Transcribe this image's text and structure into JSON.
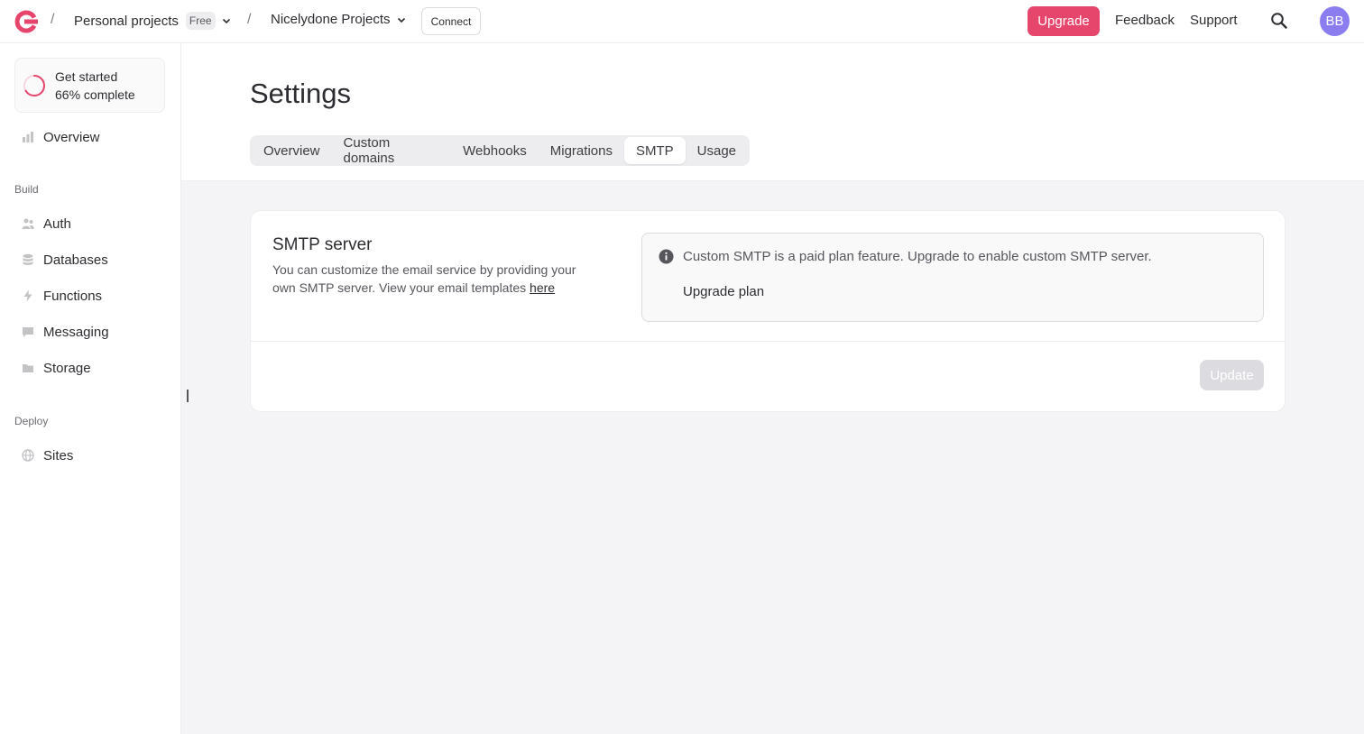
{
  "header": {
    "org_name": "Personal projects",
    "org_plan_badge": "Free",
    "project_name": "Nicelydone Projects",
    "connect_label": "Connect",
    "upgrade_label": "Upgrade",
    "feedback_label": "Feedback",
    "support_label": "Support",
    "avatar_initials": "BB",
    "accent_color": "#e6456c"
  },
  "sidebar": {
    "get_started": {
      "title": "Get started",
      "progress_text": "66% complete",
      "progress": 0.66
    },
    "overview_label": "Overview",
    "build_heading": "Build",
    "build_items": [
      "Auth",
      "Databases",
      "Functions",
      "Messaging",
      "Storage"
    ],
    "deploy_heading": "Deploy",
    "deploy_items": [
      "Sites"
    ]
  },
  "main": {
    "title": "Settings",
    "tabs": [
      {
        "label": "Overview",
        "active": false
      },
      {
        "label": "Custom domains",
        "active": false
      },
      {
        "label": "Webhooks",
        "active": false
      },
      {
        "label": "Migrations",
        "active": false
      },
      {
        "label": "SMTP",
        "active": true
      },
      {
        "label": "Usage",
        "active": false
      }
    ],
    "smtp_card": {
      "title": "SMTP server",
      "description": "You can customize the email service by providing your own SMTP server. View your email templates",
      "description_link": "here",
      "alert_text": "Custom SMTP is a paid plan feature. Upgrade to enable custom SMTP server.",
      "alert_link": "Upgrade plan",
      "update_label": "Update"
    }
  }
}
